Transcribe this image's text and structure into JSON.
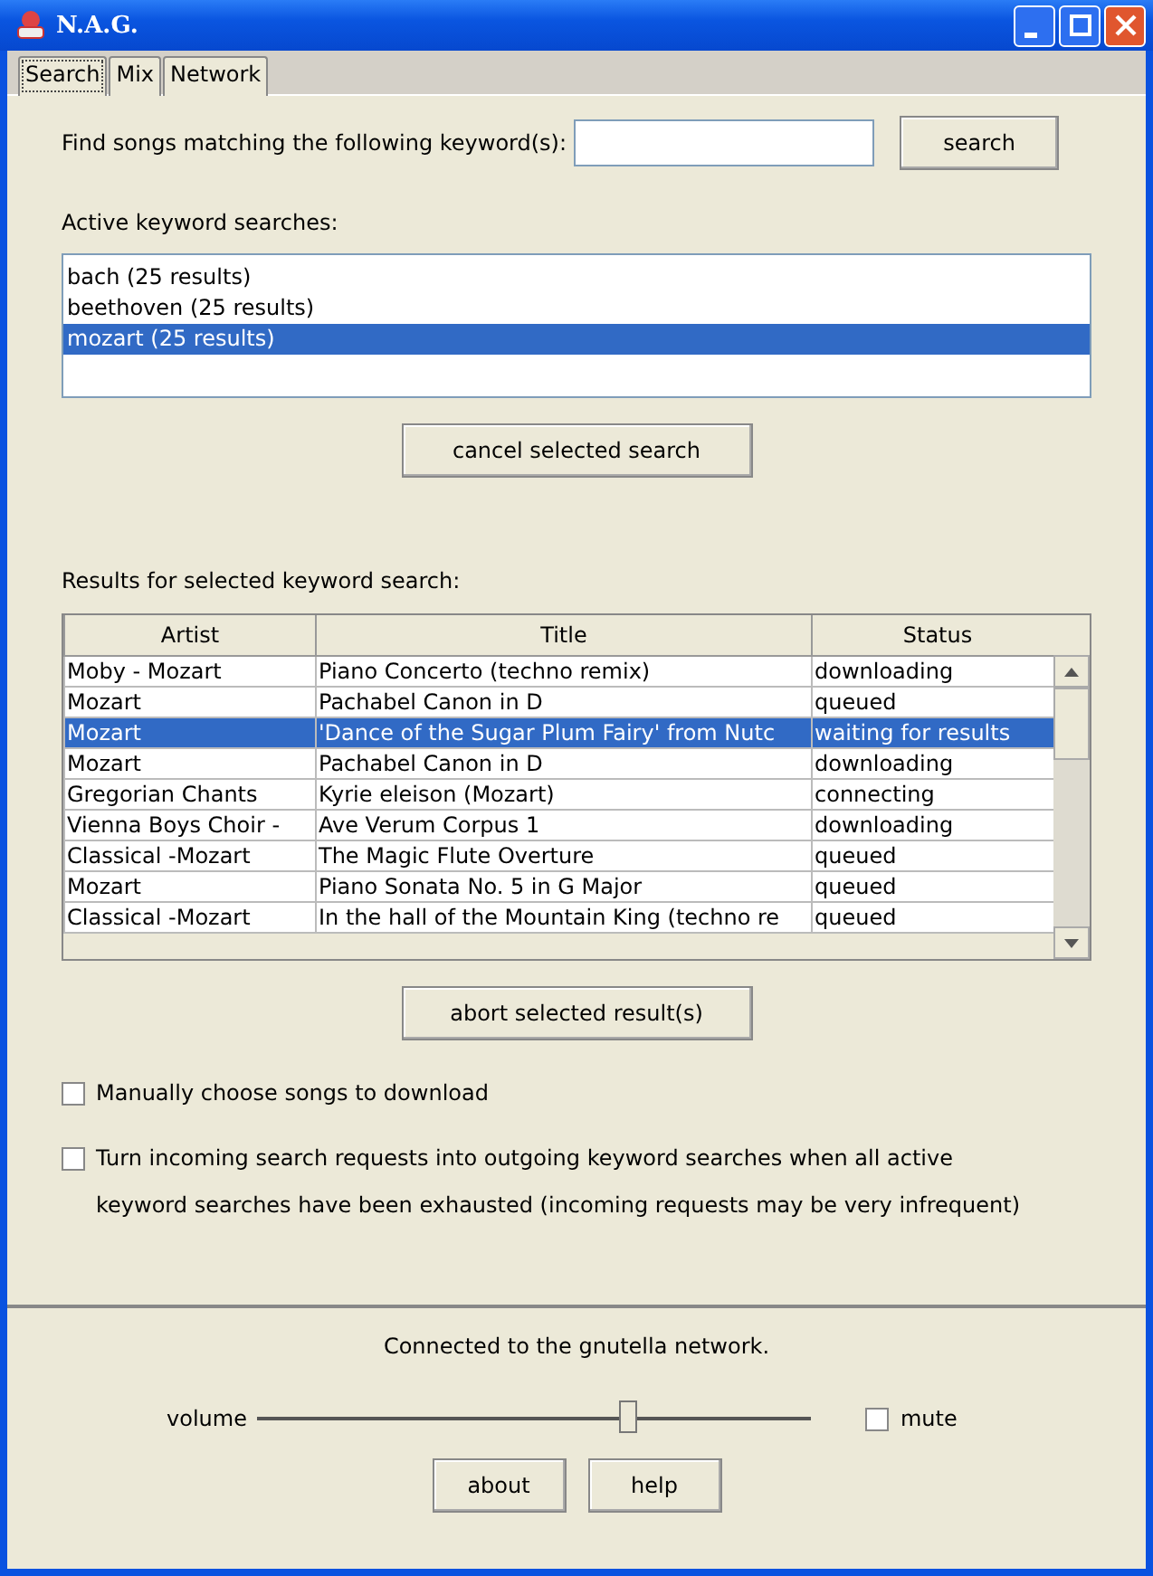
{
  "window": {
    "title": "N.A.G."
  },
  "tabs": [
    {
      "label": "Search",
      "selected": true
    },
    {
      "label": "Mix",
      "selected": false
    },
    {
      "label": "Network",
      "selected": false
    }
  ],
  "search": {
    "label": "Find songs matching the following keyword(s):",
    "button": "search"
  },
  "active_searches": {
    "label": "Active keyword searches:",
    "items": [
      {
        "text": "bach (25 results)",
        "selected": false
      },
      {
        "text": "beethoven (25 results)",
        "selected": false
      },
      {
        "text": "mozart (25 results)",
        "selected": true
      }
    ],
    "button": "cancel selected search"
  },
  "results": {
    "label": "Results for selected keyword search:",
    "columns": [
      "Artist",
      "Title",
      "Status"
    ],
    "rows": [
      {
        "cells": [
          "Moby - Mozart",
          "Piano Concerto (techno remix)",
          "downloading"
        ],
        "selected": false
      },
      {
        "cells": [
          "Mozart",
          "Pachabel Canon in D",
          "queued"
        ],
        "selected": false
      },
      {
        "cells": [
          "Mozart",
          "'Dance of the Sugar Plum Fairy' from Nutc",
          "waiting for results"
        ],
        "selected": true
      },
      {
        "cells": [
          "Mozart",
          "Pachabel Canon in D",
          "downloading"
        ],
        "selected": false
      },
      {
        "cells": [
          "Gregorian Chants",
          "Kyrie eleison (Mozart)",
          "connecting"
        ],
        "selected": false
      },
      {
        "cells": [
          "Vienna Boys Choir -",
          "Ave Verum Corpus 1",
          "downloading"
        ],
        "selected": false
      },
      {
        "cells": [
          "Classical -Mozart",
          "The Magic Flute Overture",
          "queued"
        ],
        "selected": false
      },
      {
        "cells": [
          "Mozart",
          "Piano Sonata No. 5 in G Major",
          "queued"
        ],
        "selected": false
      },
      {
        "cells": [
          "Classical -Mozart",
          "In the hall of the Mountain King (techno re",
          "queued"
        ],
        "selected": false
      }
    ],
    "button": "abort selected result(s)"
  },
  "options": [
    {
      "label": "Manually choose songs to download",
      "checked": false
    },
    {
      "label": "Turn incoming search requests into outgoing keyword searches when all active keyword searches have been exhausted (incoming requests may be very infrequent)",
      "checked": false
    }
  ],
  "status_bar": {
    "text": "Connected to the gnutella network.",
    "volume_label": "volume",
    "volume": {
      "level": 0.67
    },
    "mute": {
      "label": "mute",
      "checked": false
    },
    "buttons": [
      "about",
      "help"
    ]
  }
}
